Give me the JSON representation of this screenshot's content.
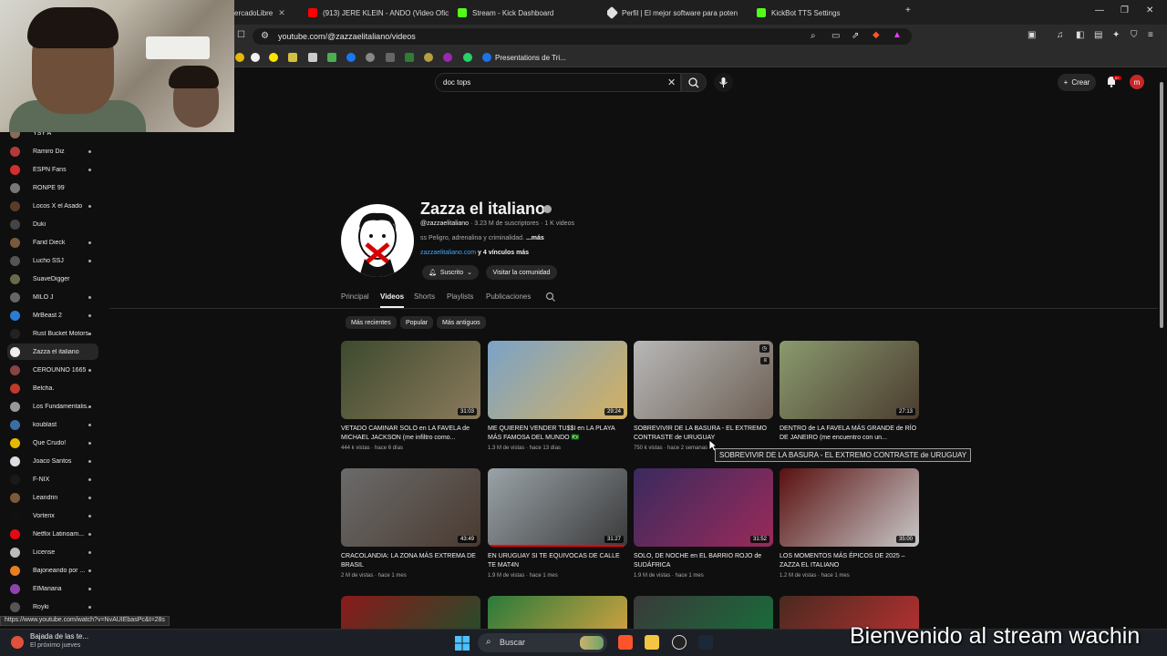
{
  "browser": {
    "tabs": [
      {
        "label": "ercadoLibre",
        "close": "✕"
      },
      {
        "label": "(913) JERE KLEIN - ANDO (Video Ofic",
        "close": "✕"
      },
      {
        "label": "Stream - Kick Dashboard",
        "close": "✕"
      },
      {
        "label": "Perfil | El mejor software para poten",
        "close": "✕"
      },
      {
        "label": "KickBot TTS Settings",
        "close": "✕"
      }
    ],
    "new_tab": "+",
    "url": "youtube.com/@zazzaelitaliano/videos",
    "bookmark_label": "Presentations de Tri...",
    "status_url": "https://www.youtube.com/watch?v=NvAUIEbasPc&t=28s"
  },
  "youtube": {
    "search": {
      "value": "doc tops",
      "clear": "✕"
    },
    "create_label": "Crear",
    "notif_badge": "9+",
    "user_initial": "m"
  },
  "sidebar": {
    "items": [
      {
        "label": "YSY A",
        "color": "#8a6b5a",
        "dot": false
      },
      {
        "label": "Ramiro Diz",
        "color": "#b23a3a",
        "dot": true
      },
      {
        "label": "ESPN Fans",
        "color": "#d32f2f",
        "dot": true
      },
      {
        "label": "RONPE 99´",
        "color": "#777777",
        "dot": false
      },
      {
        "label": "Locos X el Asado",
        "color": "#5a3b2a",
        "dot": true
      },
      {
        "label": "Duki",
        "color": "#444444",
        "dot": false
      },
      {
        "label": "Farid Dieck",
        "color": "#7a5a3a",
        "dot": true
      },
      {
        "label": "Lucho SSJ",
        "color": "#555555",
        "dot": true
      },
      {
        "label": "SuaveDigger",
        "color": "#6a6a4a",
        "dot": false
      },
      {
        "label": "MILO J",
        "color": "#666666",
        "dot": true
      },
      {
        "label": "MrBeast 2",
        "color": "#2b7bd6",
        "dot": true
      },
      {
        "label": "Rust Bucket Motors...",
        "color": "#222222",
        "dot": true
      },
      {
        "label": "Zazza el italiano",
        "color": "#eeeeee",
        "dot": false
      },
      {
        "label": "CEROUNNO 1665",
        "color": "#884444",
        "dot": true
      },
      {
        "label": "Belcha.",
        "color": "#c0392b",
        "dot": false
      },
      {
        "label": "Los Fundamentalis...",
        "color": "#999999",
        "dot": true
      },
      {
        "label": "koublast",
        "color": "#3a6ea5",
        "dot": true
      },
      {
        "label": "Que Crudo!",
        "color": "#e6b800",
        "dot": true
      },
      {
        "label": "Joaco Santos",
        "color": "#dddddd",
        "dot": true
      },
      {
        "label": "F-NIX",
        "color": "#1a1a1a",
        "dot": true
      },
      {
        "label": "Leandrin",
        "color": "#7a5a3a",
        "dot": true
      },
      {
        "label": "Vorterix",
        "color": "#111111",
        "dot": true
      },
      {
        "label": "Netflix Latinoam...",
        "color": "#e50914",
        "dot": true
      },
      {
        "label": "License",
        "color": "#bbbbbb",
        "dot": true
      },
      {
        "label": "Bajoneando por ...",
        "color": "#e67e22",
        "dot": true
      },
      {
        "label": "ElMariana",
        "color": "#8e44ad",
        "dot": true
      },
      {
        "label": "Royki",
        "color": "#555555",
        "dot": true
      }
    ]
  },
  "channel": {
    "name": "Zazza el italiano",
    "handle": "@zazzaelitaliano",
    "stats": " · 3.23 M de suscriptores · 1 K videos",
    "desc": "Peligro, adrenalina y criminalidad.",
    "desc_more": "...más",
    "link": "zazzaelitaliano.com",
    "link_more": "y 4 vínculos más",
    "subscribed_label": "Suscrito",
    "community_label": "Visitar la comunidad"
  },
  "tabs": [
    "Principal",
    "Videos",
    "Shorts",
    "Playlists",
    "Publicaciones"
  ],
  "chips": [
    "Más recientes",
    "Popular",
    "Más antiguos"
  ],
  "videos": [
    {
      "title": "VETADO CAMINAR SOLO en LA FAVELA de MICHAEL JACKSON (me infiltro como...",
      "meta": "444 k vistas · hace 6 días",
      "duration": "31:03",
      "c1": "#3d4a2e",
      "c2": "#8b7a5c",
      "progress": 0
    },
    {
      "title": "ME QUIEREN VENDER TU$$I en LA PLAYA MÁS FAMOSA DEL MUNDO 🇧🇷",
      "meta": "1.3 M de vistas · hace 13 días",
      "duration": "29:24",
      "c1": "#7aa3c9",
      "c2": "#d4b060",
      "progress": 0
    },
    {
      "title": "SOBREVIVIR DE LA BASURA - EL EXTREMO CONTRASTE de URUGUAY",
      "meta": "750 k vistas · hace 2 semanas",
      "duration": "",
      "c1": "#b8b8b8",
      "c2": "#6d6055",
      "progress": 0
    },
    {
      "title": "DENTRO de LA FAVELA MÁS GRANDE de RÍO DE JANEIRO (me encuentro con un...",
      "meta": "",
      "duration": "27:13",
      "c1": "#8a9a6e",
      "c2": "#4b3c30",
      "progress": 0
    },
    {
      "title": "CRACOLANDIA: LA ZONA MÁS EXTREMA DE BRASIL",
      "meta": "2 M de vistas · hace 1 mes",
      "duration": "43:49",
      "c1": "#6b6b6b",
      "c2": "#4a3a30",
      "progress": 0
    },
    {
      "title": "EN URUGUAY SI TE EQUIVOCAS DE CALLE TE MAT4N",
      "meta": "1.9 M de vistas · hace 1 mes",
      "duration": "31:27",
      "c1": "#9aa3a8",
      "c2": "#3a3a3a",
      "progress": 1.0
    },
    {
      "title": "SOLO, DE NOCHE en EL BARRIO ROJO de SUDÁFRICA",
      "meta": "1.9 M de vistas · hace 1 mes",
      "duration": "31:52",
      "c1": "#3a2a5e",
      "c2": "#9a2a5a",
      "progress": 0
    },
    {
      "title": "LOS MOMENTOS MÁS ÉPICOS DE 2025 – ZAZZA EL ITALIANO",
      "meta": "1.2 M de vistas · hace 1 mes",
      "duration": "35:00",
      "c1": "#5a1010",
      "c2": "#c8c8c8",
      "progress": 0
    }
  ],
  "tooltip": "SOBREVIVIR DE LA BASURA - EL EXTREMO CONTRASTE de URUGUAY",
  "taskbar": {
    "weather_title": "Bajada de las te...",
    "weather_sub": "El próximo jueves",
    "search_label": "Buscar"
  },
  "overlay_text": "Bienvenido al stream wachin"
}
